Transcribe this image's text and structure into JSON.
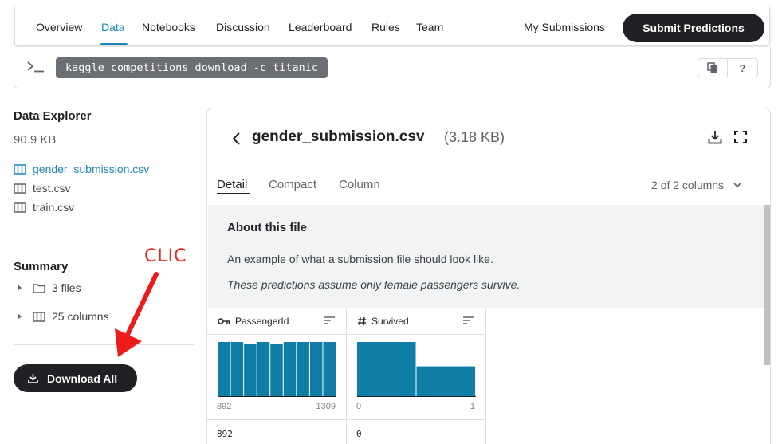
{
  "nav": {
    "tabs": [
      "Overview",
      "Data",
      "Notebooks",
      "Discussion",
      "Leaderboard",
      "Rules",
      "Team"
    ],
    "active_tab": "Data",
    "my_submissions": "My Submissions",
    "submit_label": "Submit Predictions"
  },
  "command": {
    "text": "kaggle competitions download -c titanic",
    "help": "?"
  },
  "sidebar": {
    "title": "Data Explorer",
    "size": "90.9 KB",
    "files": [
      {
        "name": "gender_submission.csv",
        "active": true
      },
      {
        "name": "test.csv",
        "active": false
      },
      {
        "name": "train.csv",
        "active": false
      }
    ],
    "summary_title": "Summary",
    "summary_items": [
      {
        "icon": "folder-icon",
        "label": "3 files"
      },
      {
        "icon": "columns-icon",
        "label": "25 columns"
      }
    ],
    "download_all": "Download All"
  },
  "annotation": {
    "text": "CLIC",
    "color": "#e8261f"
  },
  "panel": {
    "file_name": "gender_submission.csv",
    "file_size": "(3.18 KB)",
    "view_tabs": [
      "Detail",
      "Compact",
      "Column"
    ],
    "active_view": "Detail",
    "column_count": "2 of 2 columns",
    "about_title": "About this file",
    "about_desc": "An example of what a submission file should look like.",
    "about_note": "These predictions assume only female passengers survive.",
    "columns": [
      {
        "name": "PassengerId",
        "type": "key-icon",
        "min": "892",
        "max": "1309",
        "first_value": "892",
        "histogram": [
          1,
          1,
          0.97,
          1,
          0.96,
          1,
          1,
          1,
          1
        ]
      },
      {
        "name": "Survived",
        "type": "hash-icon",
        "min": "0",
        "max": "1",
        "first_value": "0",
        "histogram": [
          1,
          0.55
        ]
      }
    ]
  },
  "colors": {
    "accent": "#1a86b8",
    "bar": "#0e7ea6",
    "dark": "#202124"
  }
}
